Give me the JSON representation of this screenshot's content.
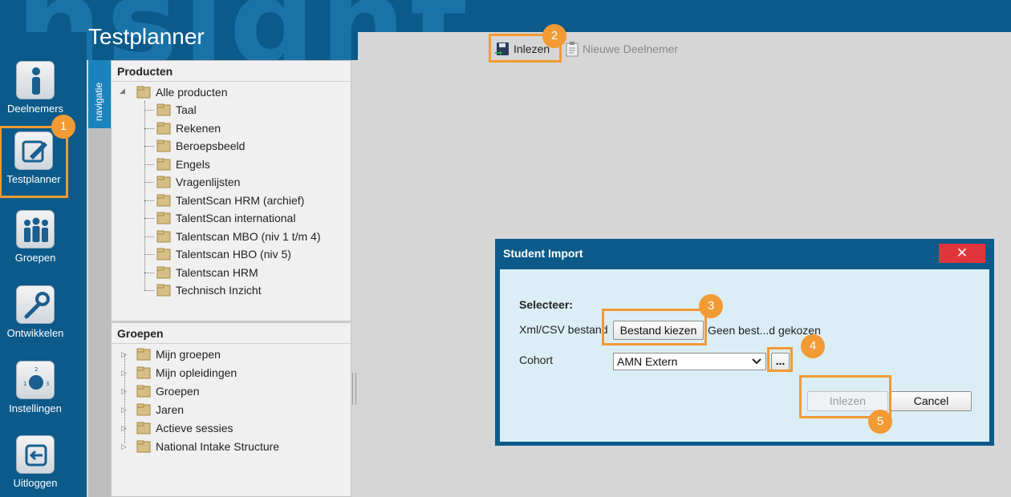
{
  "app": {
    "brand_word": "nsight",
    "title": "Testplanner"
  },
  "sidebar": {
    "items": [
      {
        "label": "Deelnemers",
        "icon": "person-icon"
      },
      {
        "label": "Testplanner",
        "icon": "notepad-pencil-icon",
        "active": true
      },
      {
        "label": "Groepen",
        "icon": "group-icon"
      },
      {
        "label": "Ontwikkelen",
        "icon": "wrench-icon"
      },
      {
        "label": "Instellingen",
        "icon": "dial-icon"
      },
      {
        "label": "Uitloggen",
        "icon": "logout-arrow-icon"
      }
    ]
  },
  "toolbar": {
    "inlezen_label": "Inlezen",
    "nieuwe_label": "Nieuwe Deelnemer"
  },
  "navigation_tab": "navigatie",
  "producten": {
    "title": "Producten",
    "root": "Alle producten",
    "items": [
      "Taal",
      "Rekenen",
      "Beroepsbeeld",
      "Engels",
      "Vragenlijsten",
      "TalentScan HRM (archief)",
      "TalentScan international",
      "Talentscan MBO (niv 1 t/m 4)",
      "Talentscan HBO (niv 5)",
      "Talentscan HRM",
      "Technisch Inzicht"
    ]
  },
  "groepen": {
    "title": "Groepen",
    "items": [
      "Mijn groepen",
      "Mijn opleidingen",
      "Groepen",
      "Jaren",
      "Actieve sessies",
      "National Intake Structure"
    ]
  },
  "dialog": {
    "title": "Student Import",
    "close_symbol": "✕",
    "select_label": "Selecteer:",
    "file_label": "Xml/CSV bestand",
    "choose_file_label": "Bestand kiezen",
    "no_file_text": "Geen best...d gekozen",
    "cohort_label": "Cohort",
    "cohort_value": "AMN Extern",
    "more_label": "...",
    "submit_label": "Inlezen",
    "cancel_label": "Cancel"
  },
  "callouts": [
    "1",
    "2",
    "3",
    "4",
    "5"
  ],
  "colors": {
    "brand_blue": "#0b5a8a",
    "callout_orange": "#f29a34",
    "close_red": "#e0353a",
    "dialog_body": "#dbeef6"
  }
}
